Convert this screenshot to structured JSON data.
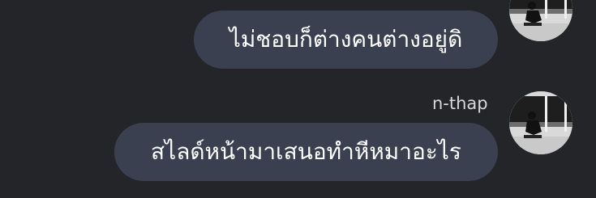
{
  "chat": {
    "messages": [
      {
        "text": "ไม่ชอบก็ต่างคนต่างอยู่ดิ",
        "avatar_icon": "user-avatar-photo"
      },
      {
        "sender": "n-thap",
        "text": "สไลด์หน้ามาเสนอทำหีหมาอะไร",
        "avatar_icon": "user-avatar-photo"
      }
    ]
  },
  "colors": {
    "background": "#242529",
    "bubble": "#3a4050",
    "text": "#ffffff",
    "sender": "#d8d8d8"
  }
}
